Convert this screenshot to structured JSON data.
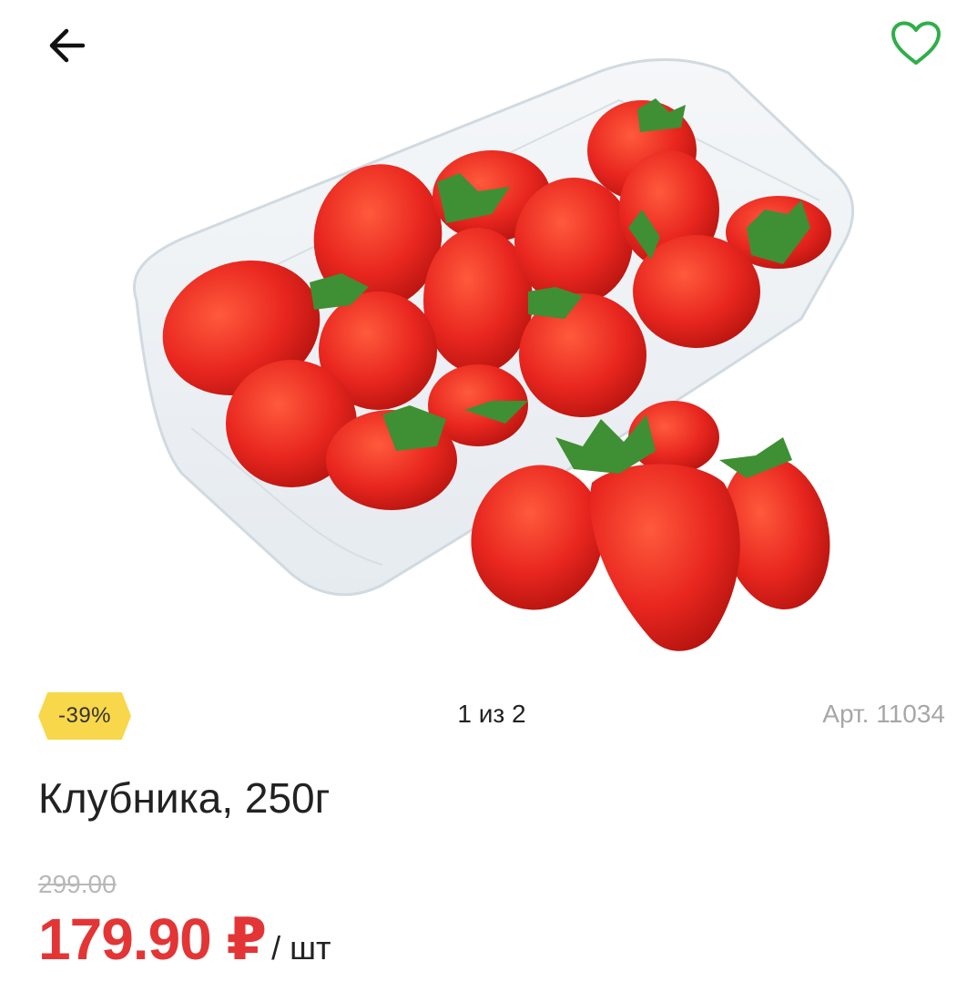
{
  "header": {
    "back_icon": "arrow-left-icon",
    "favorite_icon": "heart-outline-icon",
    "favorite_color": "#2fae4a"
  },
  "gallery": {
    "discount_badge": "-39%",
    "pager": "1 из 2"
  },
  "product": {
    "article": "Арт. 11034",
    "title": "Клубника, 250г",
    "old_price": "299.00",
    "price": "179.90 ₽",
    "unit": "/ шт"
  },
  "colors": {
    "price": "#e33535",
    "badge": "#f8d74b",
    "strawberry": "#e8261f",
    "leaf": "#3f8f34"
  }
}
